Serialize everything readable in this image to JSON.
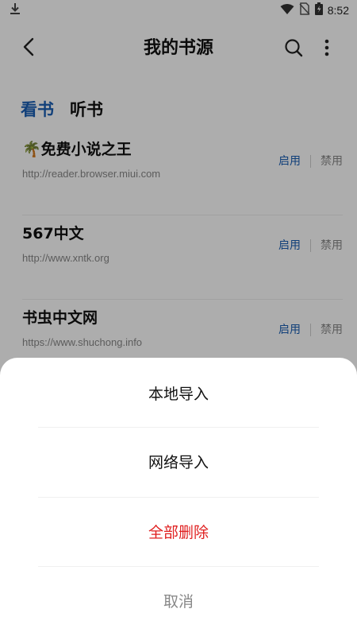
{
  "status_bar": {
    "time": "8:52",
    "icons": [
      "download-icon",
      "wifi-icon",
      "no-sim-icon",
      "battery-icon"
    ]
  },
  "header": {
    "title": "我的书源",
    "back_icon": "chevron-left-icon",
    "search_icon": "search-icon",
    "more_icon": "more-vertical-icon"
  },
  "tabs": [
    {
      "label": "看书",
      "active": true
    },
    {
      "label": "听书",
      "active": false
    }
  ],
  "sources": [
    {
      "name": "🌴免费小说之王",
      "url": "http://reader.browser.miui.com",
      "enable_label": "启用",
      "disable_label": "禁用"
    },
    {
      "name": "567中文",
      "url": "http://www.xntk.org",
      "enable_label": "启用",
      "disable_label": "禁用"
    },
    {
      "name": "书虫中文网",
      "url": "https://www.shuchong.info",
      "enable_label": "启用",
      "disable_label": "禁用"
    }
  ],
  "bottom_sheet": {
    "local_import": "本地导入",
    "network_import": "网络导入",
    "delete_all": "全部删除",
    "cancel": "取消"
  },
  "colors": {
    "accent": "#1a5fb4",
    "danger": "#e02020",
    "muted": "#888888"
  }
}
